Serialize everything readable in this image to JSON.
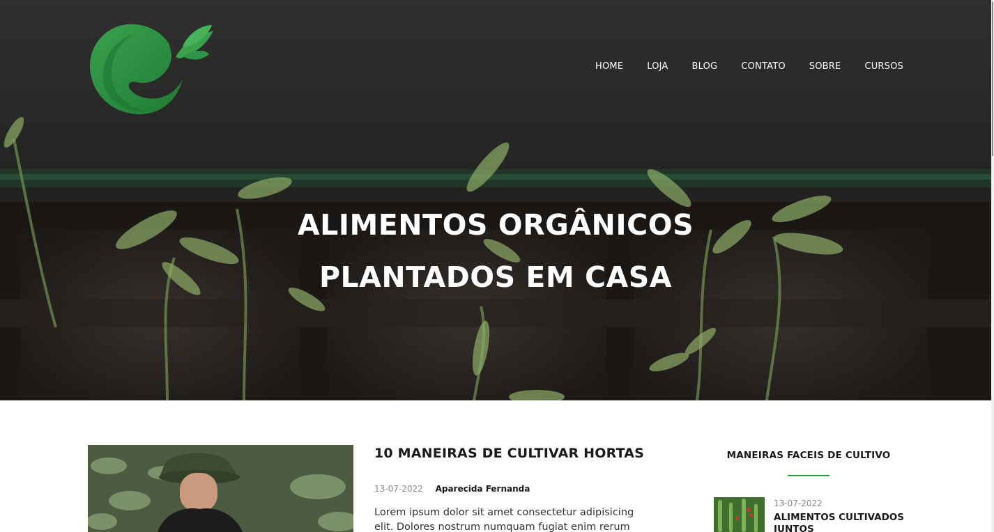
{
  "nav": {
    "items": [
      "HOME",
      "LOJA",
      "BLOG",
      "CONTATO",
      "SOBRE",
      "CURSOS"
    ]
  },
  "hero": {
    "line1": "ALIMENTOS ORGÂNICOS",
    "line2": "PLANTADOS EM CASA"
  },
  "post": {
    "title": "10 MANEIRAS DE CULTIVAR HORTAS",
    "date": "13-07-2022",
    "author": "Aparecida Fernanda",
    "excerpt": "Lorem ipsum dolor sit amet consectetur adipisicing elit. Dolores nostrum numquam fugiat enim rerum"
  },
  "sidebar": {
    "title": "MANEIRAS FACEIS DE CULTIVO",
    "items": [
      {
        "date": "13-07-2022",
        "title": "ALIMENTOS CULTIVADOS JUNTOS"
      }
    ]
  },
  "colors": {
    "accent": "#2e9e3a",
    "logo": "#2f9648"
  },
  "icons": {
    "logo": "leaf-ring-logo-icon"
  }
}
